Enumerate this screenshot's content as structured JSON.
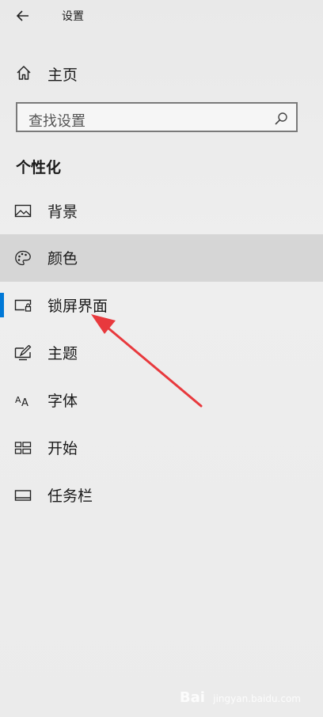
{
  "window": {
    "title": "设置"
  },
  "home": {
    "label": "主页"
  },
  "search": {
    "placeholder": "查找设置"
  },
  "section": {
    "title": "个性化"
  },
  "nav": {
    "items": [
      {
        "label": "背景",
        "icon": "image-icon"
      },
      {
        "label": "颜色",
        "icon": "palette-icon"
      },
      {
        "label": "锁屏界面",
        "icon": "lock-screen-icon",
        "selected": true
      },
      {
        "label": "主题",
        "icon": "theme-pen-icon"
      },
      {
        "label": "字体",
        "icon": "font-icon"
      },
      {
        "label": "开始",
        "icon": "start-tiles-icon"
      },
      {
        "label": "任务栏",
        "icon": "taskbar-icon"
      }
    ]
  },
  "colors": {
    "accent": "#0078d7",
    "annotation_arrow": "#e8393d"
  },
  "watermark": {
    "brand": "Bai",
    "site": "jingyan.baidu.com"
  }
}
